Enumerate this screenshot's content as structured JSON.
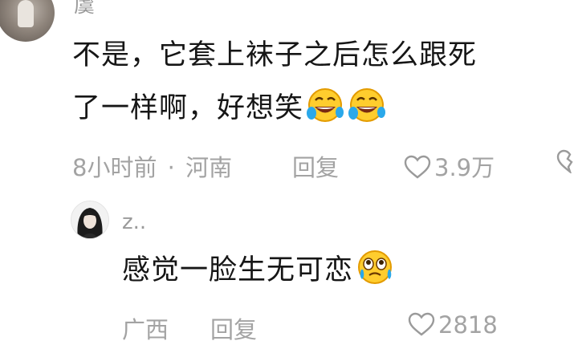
{
  "comment1": {
    "username": "虞",
    "text_line1": "不是，它套上袜子之后怎么跟死",
    "text_line2": "了一样啊，好想笑",
    "time": "8小时前",
    "separator": "·",
    "location": "河南",
    "reply_label": "回复",
    "likes": "3.9万"
  },
  "comment2": {
    "username": "z..",
    "text": "感觉一脸生无可恋",
    "time": "广西",
    "reply_label": "回复",
    "likes": "2818"
  },
  "icons": {
    "laugh_emoji": "rolling-on-floor-laughing-emoji",
    "speechless_emoji": "pleading-face-emoji",
    "heart": "heart-outline-icon",
    "dislike": "broken-heart-icon"
  }
}
